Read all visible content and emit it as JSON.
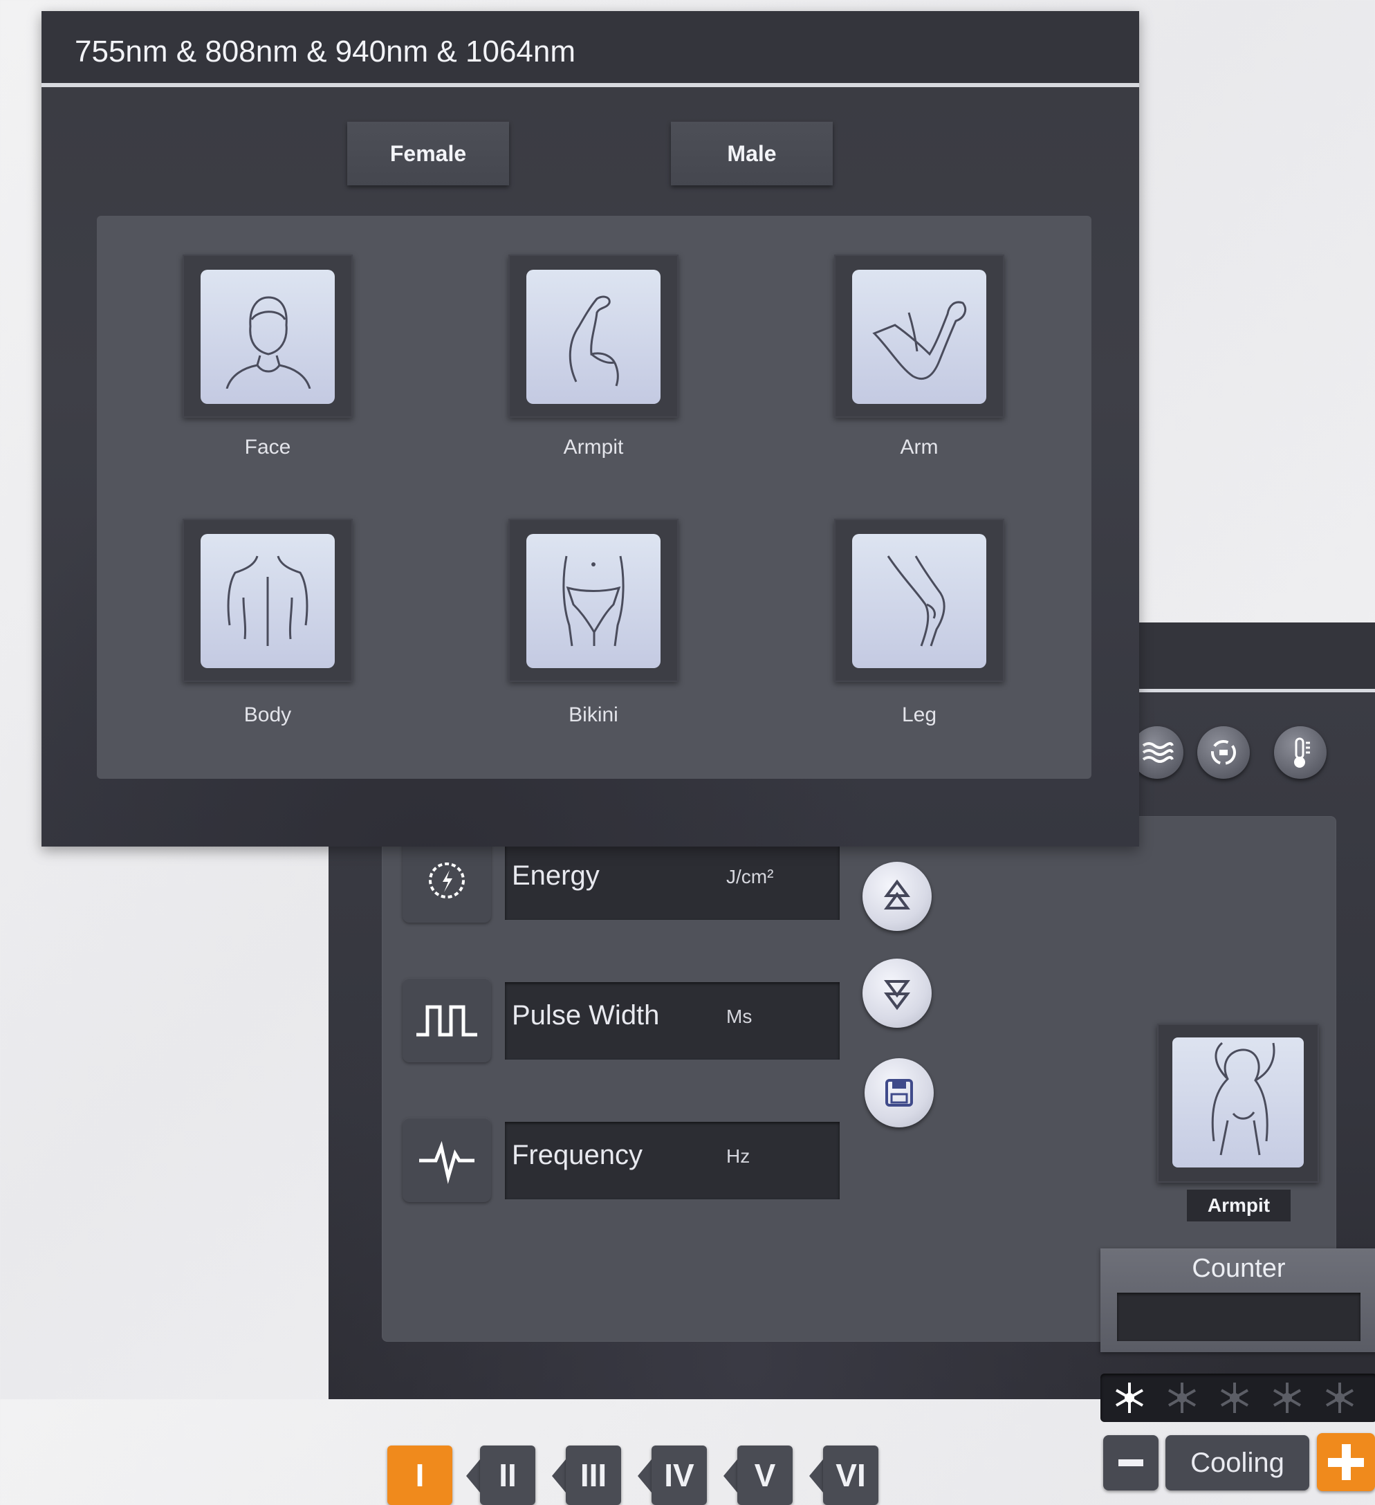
{
  "front_screen": {
    "title": "755nm & 808nm & 940nm & 1064nm",
    "gender_buttons": [
      "Female",
      "Male"
    ],
    "areas": [
      {
        "label": "Face",
        "icon": "face-icon"
      },
      {
        "label": "Armpit",
        "icon": "armpit-icon"
      },
      {
        "label": "Arm",
        "icon": "arm-icon"
      },
      {
        "label": "Body",
        "icon": "body-back-icon"
      },
      {
        "label": "Bikini",
        "icon": "bikini-icon"
      },
      {
        "label": "Leg",
        "icon": "leg-icon"
      }
    ]
  },
  "back_screen": {
    "top_icons": [
      "waves-icon",
      "cycle-icon",
      "thermometer-icon"
    ],
    "params": [
      {
        "label": "Energy",
        "unit": "J/cm²",
        "icon": "energy-icon"
      },
      {
        "label": "Pulse Width",
        "unit": "Ms",
        "icon": "pulse-wave-icon"
      },
      {
        "label": "Frequency",
        "unit": "Hz",
        "icon": "heartbeat-icon"
      }
    ],
    "adjust_buttons": [
      "increase-icon",
      "decrease-icon",
      "save-icon"
    ],
    "selected_area": "Armpit",
    "counter_title": "Counter",
    "cooling": {
      "label": "Cooling",
      "level": 1,
      "max": 5
    },
    "skin_levels": [
      "I",
      "II",
      "III",
      "IV",
      "V",
      "VI"
    ],
    "active_level": "I",
    "accent_color": "#f08a1c"
  }
}
